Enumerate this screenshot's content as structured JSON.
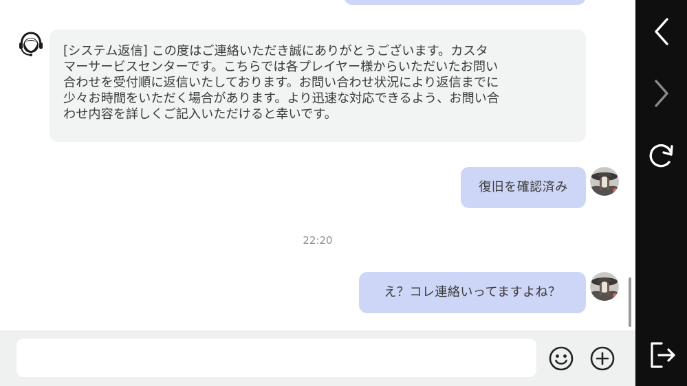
{
  "chat": {
    "messages": [
      {
        "sender": "support",
        "text": "[システム返信] この度はご連絡いただき誠にありがとうございます。カスタ\nマーサービスセンターです。こちらでは各プレイヤー様からいただいたお問い\n合わせを受付順に返信いたしております。お問い合わせ状況により返信までに\n少々お時間をいただく場合があります。より迅速な対応できるよう、お問い合\nわせ内容を詳しくご記入いただけると幸いです。"
      },
      {
        "sender": "user",
        "text": "復旧を確認済み"
      },
      {
        "sender": "user",
        "text": "え？コレ連絡いってますよね？"
      }
    ],
    "timestamp": "22:20"
  },
  "input": {
    "value": "",
    "placeholder": ""
  },
  "icons": {
    "support_avatar": "headset-agent-icon",
    "user_avatar": "user-avatar",
    "emoji": "smiley-icon",
    "add": "plus-circle-icon",
    "back": "chevron-left-icon",
    "forward": "chevron-right-icon",
    "refresh": "refresh-icon",
    "exit": "exit-icon"
  },
  "colors": {
    "user_bubble": "#cdd6f6",
    "support_bubble": "#f2f3f3",
    "side_panel": "#0f0f0f",
    "input_bar": "#eff0f0"
  }
}
